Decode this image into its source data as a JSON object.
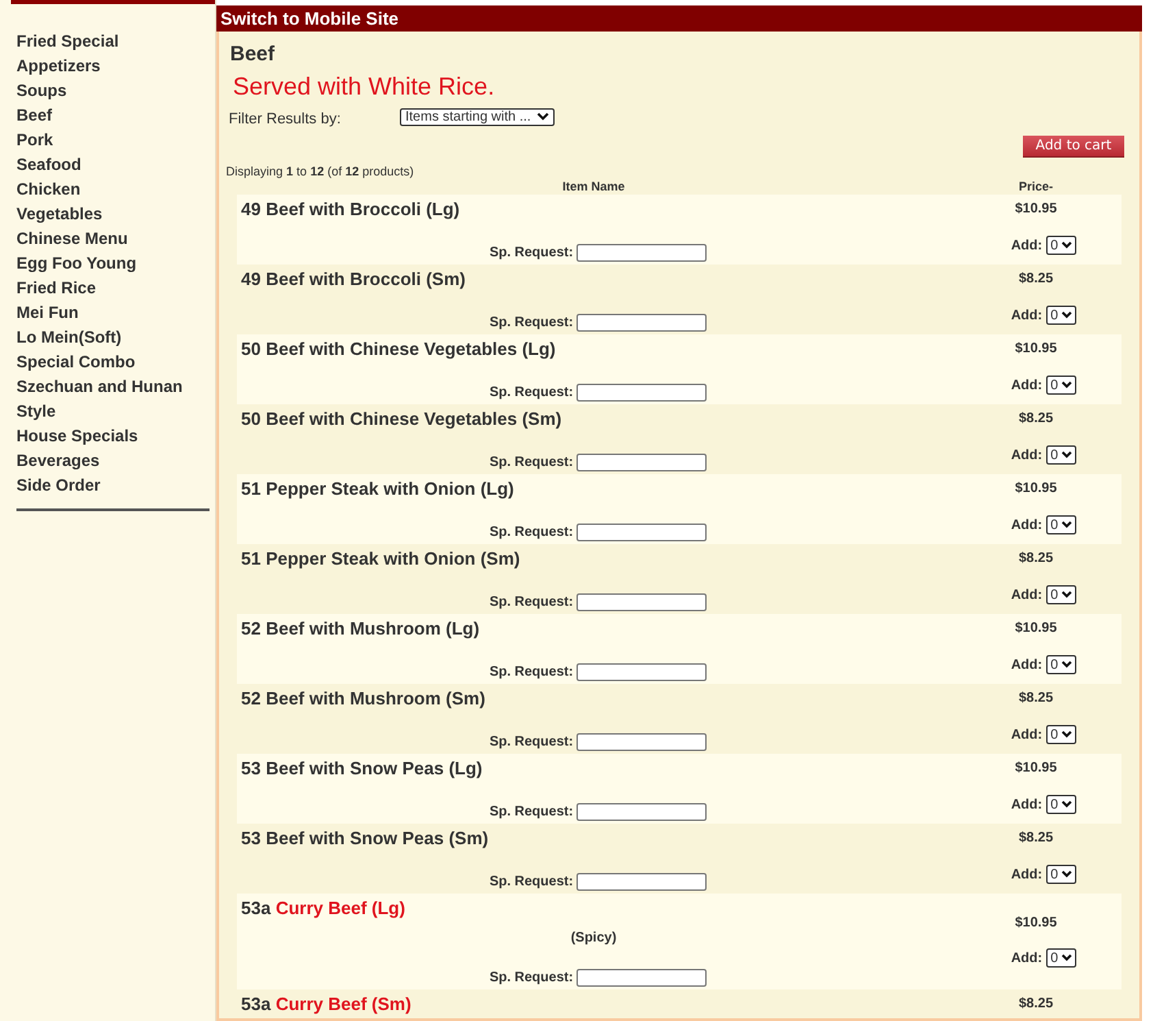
{
  "sidebar": {
    "items": [
      "Fried Special",
      "Appetizers",
      "Soups",
      "Beef",
      "Pork",
      "Seafood",
      "Chicken",
      "Vegetables",
      "Chinese Menu",
      "Egg Foo Young",
      "Fried Rice",
      "Mei Fun",
      "Lo Mein(Soft)",
      "Special Combo",
      "Szechuan and Hunan Style",
      "House Specials",
      "Beverages",
      "Side Order"
    ]
  },
  "header": {
    "link": "Switch to Mobile Site"
  },
  "category": {
    "title": "Beef",
    "subtitle": "Served with White Rice."
  },
  "filter": {
    "label": "Filter Results by:",
    "value": "Items starting with ..."
  },
  "add_to_cart": "Add to cart",
  "display_count": "Displaying **1** to **12** (of **12** products)",
  "table": {
    "columns": [
      "Item Name",
      "Price-"
    ]
  },
  "products": [
    {
      "number": "49",
      "name": "Beef with Broccoli (Lg)",
      "highlighted": false,
      "shaded": true,
      "price": "$10.95",
      "request_label": "Sp. Request:",
      "add_label": "Add:",
      "quantity": "0"
    },
    {
      "number": "49",
      "name": "Beef with Broccoli (Sm)",
      "highlighted": false,
      "shaded": false,
      "price": "$8.25",
      "request_label": "Sp. Request:",
      "add_label": "Add:",
      "quantity": "0"
    },
    {
      "number": "50",
      "name": "Beef with Chinese Vegetables (Lg)",
      "highlighted": false,
      "shaded": true,
      "price": "$10.95",
      "request_label": "Sp. Request:",
      "add_label": "Add:",
      "quantity": "0"
    },
    {
      "number": "50",
      "name": "Beef with Chinese Vegetables (Sm)",
      "highlighted": false,
      "shaded": false,
      "price": "$8.25",
      "request_label": "Sp. Request:",
      "add_label": "Add:",
      "quantity": "0"
    },
    {
      "number": "51",
      "name": "Pepper Steak with Onion (Lg)",
      "highlighted": false,
      "shaded": true,
      "price": "$10.95",
      "request_label": "Sp. Request:",
      "add_label": "Add:",
      "quantity": "0"
    },
    {
      "number": "51",
      "name": "Pepper Steak with Onion (Sm)",
      "highlighted": false,
      "shaded": false,
      "price": "$8.25",
      "request_label": "Sp. Request:",
      "add_label": "Add:",
      "quantity": "0"
    },
    {
      "number": "52",
      "name": "Beef with Mushroom (Lg)",
      "highlighted": false,
      "shaded": true,
      "price": "$10.95",
      "request_label": "Sp. Request:",
      "add_label": "Add:",
      "quantity": "0"
    },
    {
      "number": "52",
      "name": "Beef with Mushroom (Sm)",
      "highlighted": false,
      "shaded": false,
      "price": "$8.25",
      "request_label": "Sp. Request:",
      "add_label": "Add:",
      "quantity": "0"
    },
    {
      "number": "53",
      "name": "Beef with Snow Peas (Lg)",
      "highlighted": false,
      "shaded": true,
      "price": "$10.95",
      "request_label": "Sp. Request:",
      "add_label": "Add:",
      "quantity": "0"
    },
    {
      "number": "53",
      "name": "Beef with Snow Peas (Sm)",
      "highlighted": false,
      "shaded": false,
      "price": "$8.25",
      "request_label": "Sp. Request:",
      "add_label": "Add:",
      "quantity": "0"
    },
    {
      "number": "53a",
      "name": "Curry Beef (Lg)",
      "highlighted": true,
      "shaded": true,
      "note": "(Spicy)",
      "price": "$10.95",
      "request_label": "Sp. Request:",
      "add_label": "Add:",
      "quantity": "0"
    },
    {
      "number": "53a",
      "name": "Curry Beef (Sm)",
      "highlighted": true,
      "shaded": false,
      "price": "$8.25"
    }
  ]
}
